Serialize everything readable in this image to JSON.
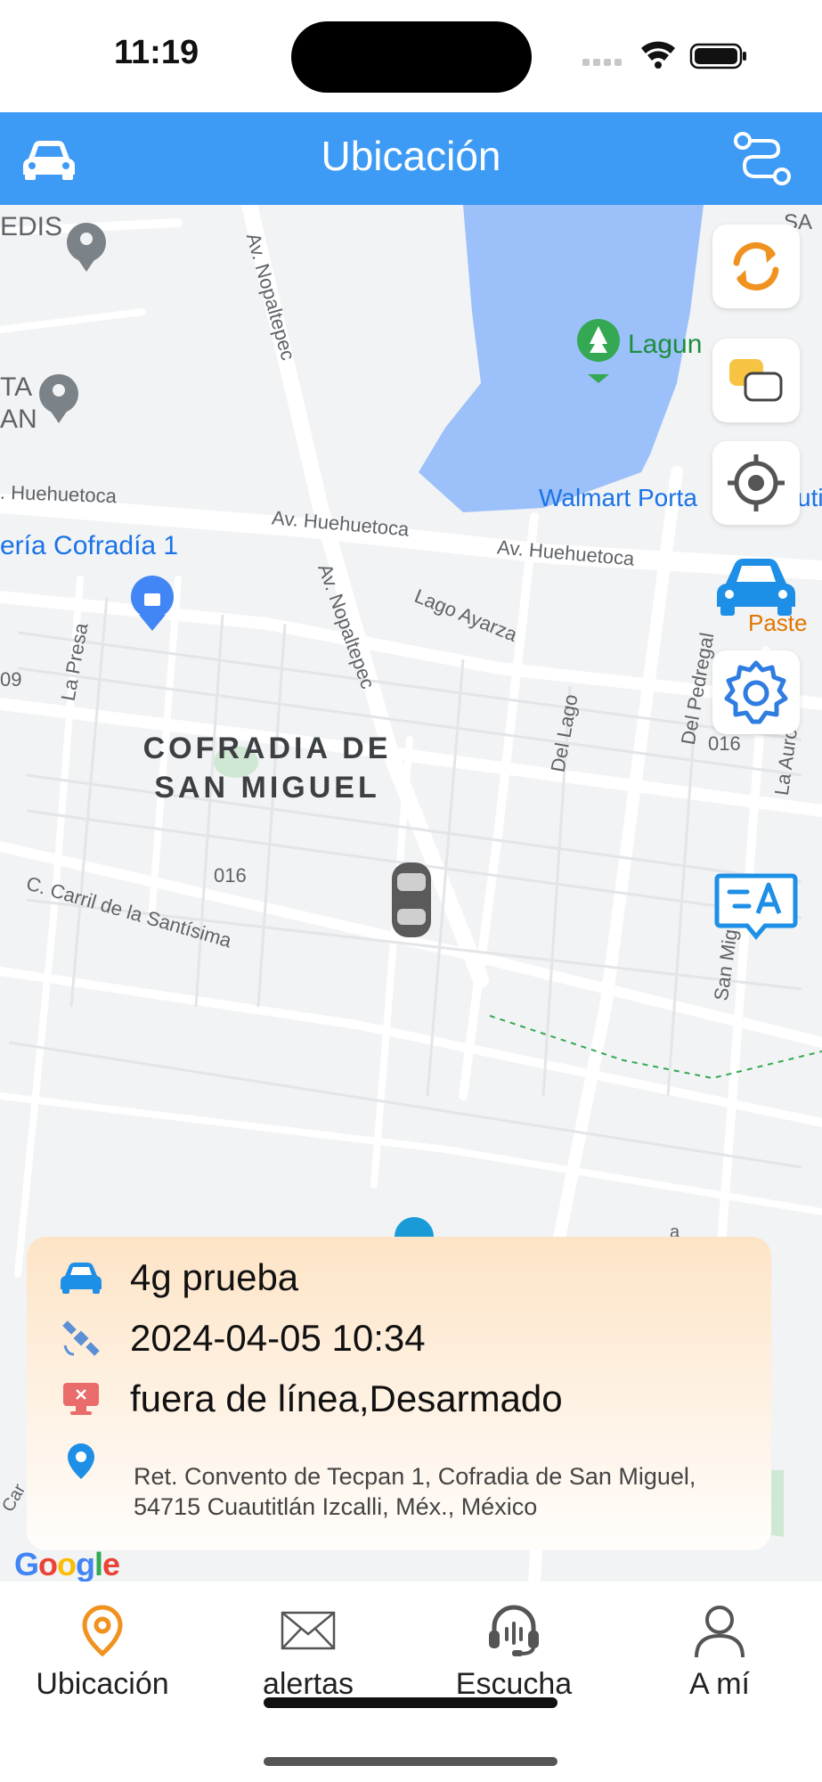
{
  "status_bar": {
    "time": "11:19"
  },
  "header": {
    "title": "Ubicación",
    "left_icon": "car-icon",
    "right_icon": "route-icon"
  },
  "map": {
    "labels": {
      "edis": "EDIS",
      "ta": "TA",
      "an": "AN",
      "sa": "SA",
      "laguna": "Lagun",
      "walmart": "Walmart Porta",
      "walmart_suffix": "uti",
      "huehuetoca_left": ". Huehuetoca",
      "huehuetoca_mid": "Av. Huehuetoca",
      "huehuetoca_right": "Av. Huehuetoca",
      "nopaltepec_top": "Av. Nopaltepec",
      "nopaltepec_mid": "Av. Nopaltepec",
      "cofradia_shop": "ería Cofradía 1",
      "lago_ayarza": "Lago Ayarza",
      "la_presa": "La Presa",
      "del_lago": "Del Lago",
      "del_pedregal": "Del Pedregal",
      "la_aurora": "La Auro",
      "pastel": "Paste",
      "area_line1": "COFRADIA DE",
      "area_line2": "SAN MIGUEL",
      "code_016_a": "016",
      "code_016_b": "016",
      "code_09": "09",
      "carril": "C. Carril de la Santísima",
      "san_mig": "San Mig",
      "a_small": "a",
      "car_small": "Car"
    },
    "side_buttons": [
      "refresh-icon",
      "map-layers-icon",
      "locate-target-icon",
      "vehicle-icon",
      "settings-gear-icon",
      "translate-chat-icon"
    ],
    "google_logo": "Google"
  },
  "info_card": {
    "vehicle_name": "4g prueba",
    "datetime": "2024-04-05 10:34",
    "status": "fuera de línea,Desarmado",
    "address": "Ret. Convento de Tecpan 1, Cofradia de San Miguel, 54715 Cuautitlán Izcalli, Méx., México"
  },
  "bottom_nav": {
    "items": [
      {
        "label": "Ubicación",
        "icon": "location-pin-icon",
        "active": true
      },
      {
        "label": "alertas",
        "icon": "envelope-icon",
        "active": false
      },
      {
        "label": "Escucha",
        "icon": "headset-icon",
        "active": false
      },
      {
        "label": "A mí",
        "icon": "user-icon",
        "active": false
      }
    ]
  },
  "colors": {
    "header_blue": "#3d9bf5",
    "accent_orange": "#f0921f",
    "map_water": "#9cc0f9",
    "map_bg": "#f1f3f4",
    "road": "#ffffff"
  }
}
